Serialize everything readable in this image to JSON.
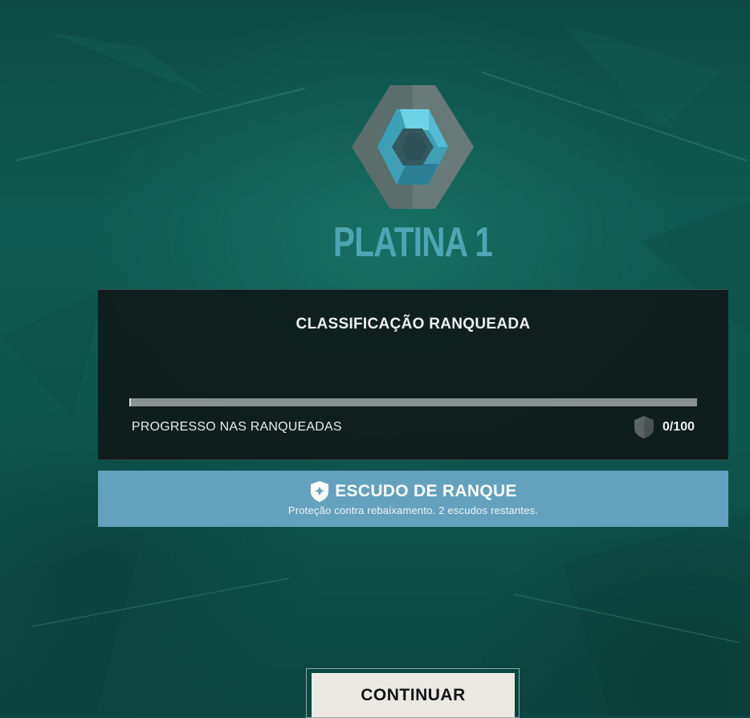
{
  "rank": {
    "icon": "platinum-rank-emblem-icon",
    "title": "PLATINA 1",
    "title_color": "#4ea6b4"
  },
  "rating_panel": {
    "title": "CLASSIFICAÇÃO RANQUEADA",
    "progress_label": "PROGRESSO NAS RANQUEADAS",
    "rr_icon": "rank-rating-shield-icon",
    "rr_value": "0/100",
    "progress_fraction": 0
  },
  "shield_banner": {
    "icon": "rank-shield-icon",
    "title": "ESCUDO DE RANQUE",
    "description": "Proteção contra rebaixamento. 2 escudos restantes.",
    "color": "#64a1bf"
  },
  "continue_button": {
    "label": "CONTINUAR"
  }
}
